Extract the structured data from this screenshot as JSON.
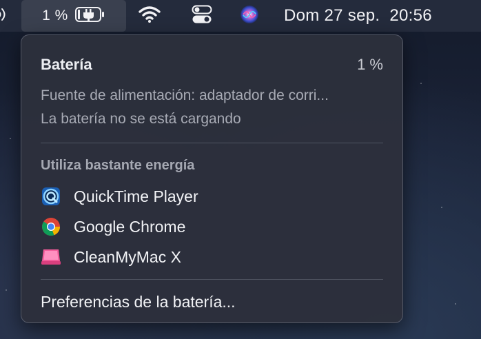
{
  "menubar": {
    "battery_percent": "1 %",
    "clock_day": "Dom 27 sep.",
    "clock_time": "20:56",
    "icons": [
      "sound-icon",
      "battery-charging-icon",
      "wifi-icon",
      "control-center-icon",
      "siri-icon"
    ]
  },
  "battery_menu": {
    "title": "Batería",
    "percent": "1 %",
    "power_source": "Fuente de alimentación: adaptador de corri...",
    "charging_status": "La batería no se está cargando",
    "energy_section_title": "Utiliza bastante energía",
    "apps": [
      {
        "name": "QuickTime Player",
        "icon": "quicktime-icon"
      },
      {
        "name": "Google Chrome",
        "icon": "chrome-icon"
      },
      {
        "name": "CleanMyMac X",
        "icon": "cleanmymac-icon"
      }
    ],
    "preferences_label": "Preferencias de la batería..."
  },
  "colors": {
    "menubar_bg": "#262c3e",
    "panel_bg": "#2c2f3c",
    "text_primary": "#eceef2",
    "text_secondary": "#a8abb5"
  }
}
